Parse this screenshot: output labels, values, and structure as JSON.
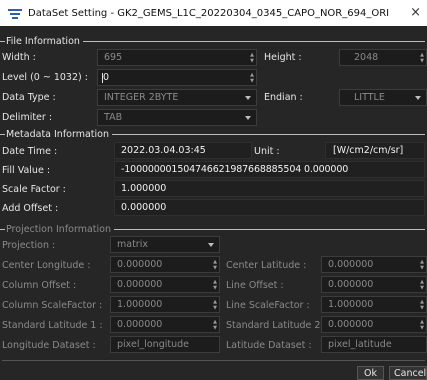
{
  "window": {
    "title": "DataSet Setting - GK2_GEMS_L1C_20220304_0345_CAPO_NOR_694_ORI",
    "close_glyph": "×"
  },
  "file_info": {
    "header": "File Information",
    "width_label": "Width :",
    "width_value": "695",
    "height_label": "Height :",
    "height_value": "2048",
    "level_label": "Level (0 ~ 1032) :",
    "level_value": "0",
    "datatype_label": "Data Type :",
    "datatype_value": "INTEGER 2BYTE",
    "endian_label": "Endian :",
    "endian_value": "LITTLE",
    "delimiter_label": "Delimiter :",
    "delimiter_value": "TAB"
  },
  "metadata": {
    "header": "Metadata Information",
    "date_label": "Date Time :",
    "date_value": "2022.03.04.03:45",
    "unit_label": "Unit :",
    "unit_value": "[W/cm2/cm/sr]",
    "fill_label": "Fill Value :",
    "fill_value": "-100000001504746621987668885504 0.000000",
    "scale_label": "Scale Factor :",
    "scale_value": "1.000000",
    "offset_label": "Add Offset :",
    "offset_value": "0.000000"
  },
  "projection": {
    "header": "Projection Information",
    "projection_label": "Projection :",
    "projection_value": "matrix",
    "center_lon_label": "Center Longitude :",
    "center_lon_value": "0.000000",
    "center_lat_label": "Center Latitude :",
    "center_lat_value": "0.000000",
    "col_offset_label": "Column Offset :",
    "col_offset_value": "0.000000",
    "line_offset_label": "Line Offset :",
    "line_offset_value": "0.000000",
    "col_scale_label": "Column ScaleFactor :",
    "col_scale_value": "1.000000",
    "line_scale_label": "Line ScaleFactor :",
    "line_scale_value": "1.000000",
    "std_lat1_label": "Standard Latitude 1 :",
    "std_lat1_value": "0.000000",
    "std_lat2_label": "Standard Latitude 2 :",
    "std_lat2_value": "0.000000",
    "lon_ds_label": "Longitude Dataset :",
    "lon_ds_value": "pixel_longitude",
    "lat_ds_label": "Latitude Dataset :",
    "lat_ds_value": "pixel_latitude"
  },
  "buttons": {
    "ok": "Ok",
    "cancel": "Cancel"
  }
}
